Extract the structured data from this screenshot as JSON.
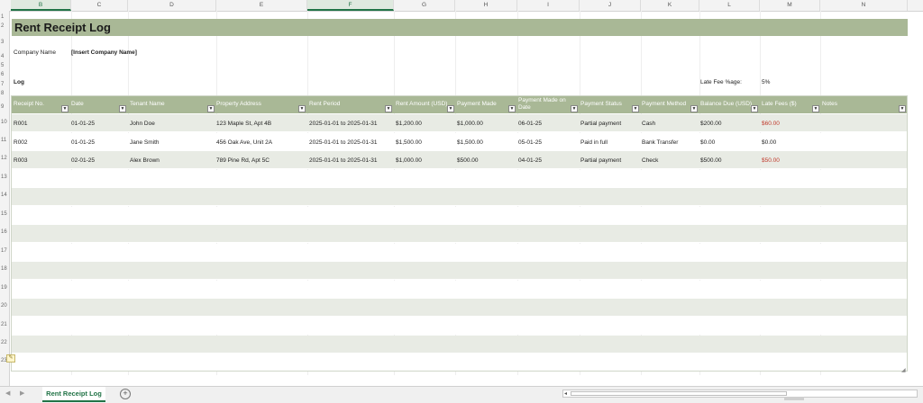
{
  "columns": [
    "B",
    "C",
    "D",
    "E",
    "F",
    "G",
    "H",
    "I",
    "J",
    "K",
    "L",
    "M",
    "N"
  ],
  "row_numbers": [
    "1",
    "2",
    "3",
    "4",
    "5",
    "6",
    "7",
    "8",
    "9",
    "10",
    "11",
    "12",
    "13",
    "14",
    "15",
    "16",
    "17",
    "18",
    "19",
    "20",
    "21",
    "22",
    "23"
  ],
  "title": "Rent Receipt Log",
  "company_label": "Company Name",
  "company_value": "[Insert Company Name]",
  "log_label": "Log",
  "late_fee_label": "Late Fee %age:",
  "late_fee_value": "5%",
  "headers": [
    "Receipt No.",
    "Date",
    "Tenant Name",
    "Property Address",
    "Rent Period",
    "Rent Amount (USD)",
    "Payment Made",
    "Payment Made on Date",
    "Payment Status",
    "Payment Method",
    "Balance Due (USD)",
    "Late Fees ($)",
    "Notes"
  ],
  "rows": [
    [
      "R001",
      "01-01-25",
      "John Doe",
      "123 Maple St, Apt 4B",
      "2025-01-01 to 2025-01-31",
      "$1,200.00",
      "$1,000.00",
      "06-01-25",
      "Partial payment",
      "Cash",
      "$200.00",
      "$60.00",
      ""
    ],
    [
      "R002",
      "01-01-25",
      "Jane Smith",
      "456 Oak Ave, Unit 2A",
      "2025-01-01 to 2025-01-31",
      "$1,500.00",
      "$1,500.00",
      "05-01-25",
      "Paid in full",
      "Bank Transfer",
      "$0.00",
      "$0.00",
      ""
    ],
    [
      "R003",
      "02-01-25",
      "Alex Brown",
      "789 Pine Rd, Apt 5C",
      "2025-01-01 to 2025-01-31",
      "$1,000.00",
      "$500.00",
      "04-01-25",
      "Partial payment",
      "Check",
      "$500.00",
      "$50.00",
      ""
    ]
  ],
  "sheet_tab": "Rent Receipt Log",
  "colors": {
    "header_green": "#a9b896",
    "band": "#e8ebe4",
    "accent": "#217346",
    "late_fee_red": "#c0392b"
  }
}
